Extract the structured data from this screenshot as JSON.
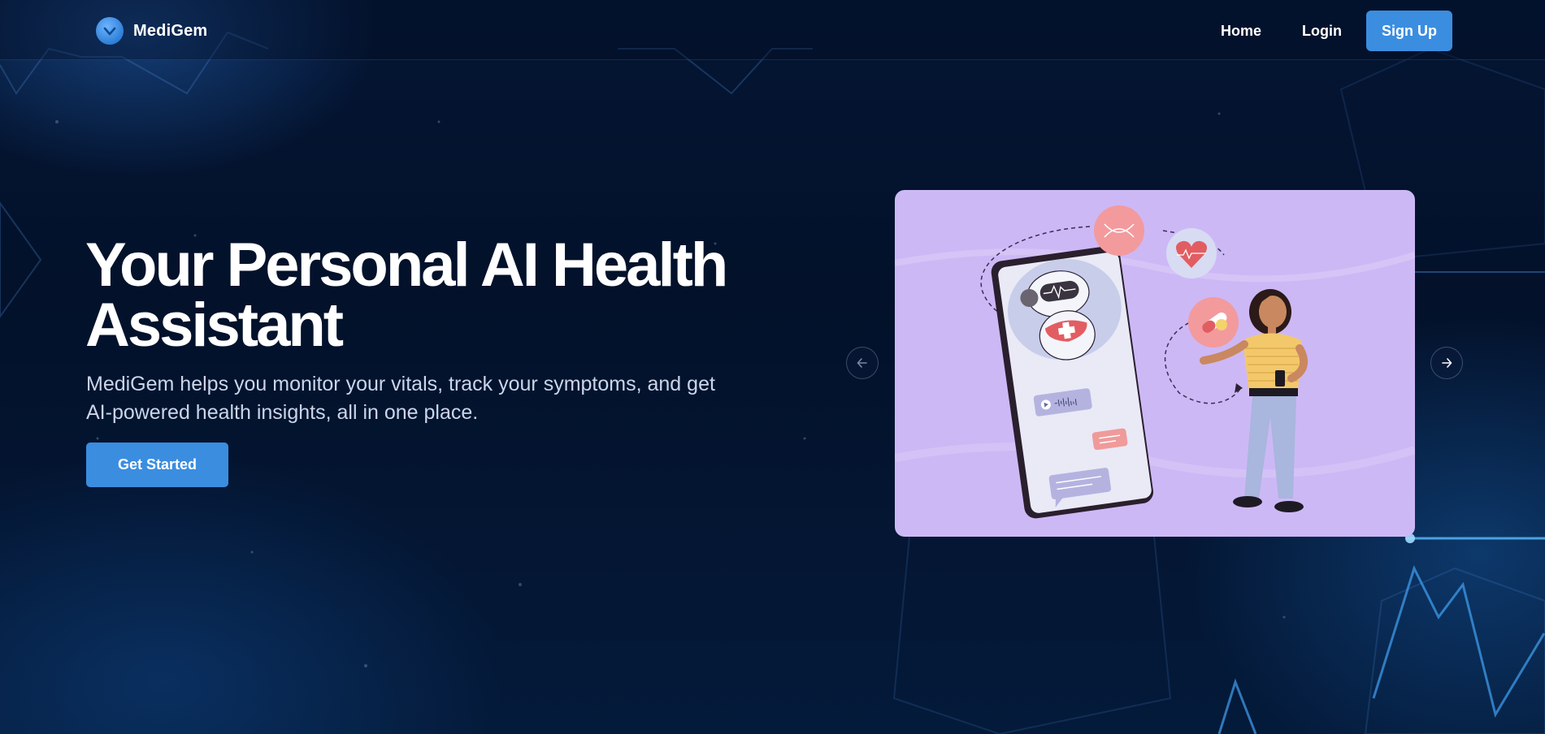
{
  "brand": {
    "name": "MediGem",
    "logo_icon": "medigem-logo-icon"
  },
  "nav": {
    "home": "Home",
    "login": "Login",
    "signup": "Sign Up"
  },
  "hero": {
    "title": "Your Personal AI Health Assistant",
    "subtitle": "MediGem helps you monitor your vitals, track your symptoms, and get AI-powered health insights, all in one place.",
    "cta": "Get Started"
  },
  "carousel": {
    "prev_icon": "arrow-left-icon",
    "next_icon": "arrow-right-icon",
    "slide_illustration": "ai-health-assistant-phone-illustration"
  },
  "colors": {
    "accent": "#3b8de0",
    "background": "#03112a",
    "slide_bg": "#cdb8f6"
  }
}
